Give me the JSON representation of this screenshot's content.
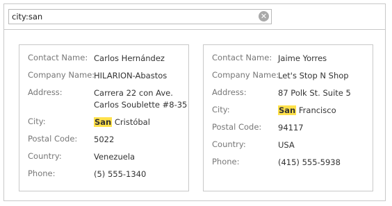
{
  "search": {
    "value": "city:san",
    "placeholder": ""
  },
  "cards": [
    {
      "fields": [
        {
          "label": "Contact Name:",
          "value": "Carlos Hernández"
        },
        {
          "label": "Company Name:",
          "value": "HILARION-Abastos"
        },
        {
          "label": "Address:",
          "value_line1": "Carrera 22 con Ave.",
          "value_line2": "Carlos Soublette #8-35"
        },
        {
          "label": "City:",
          "highlight": "San",
          "rest": "Cristóbal"
        },
        {
          "label": "Postal Code:",
          "value": "5022"
        },
        {
          "label": "Country:",
          "value": "Venezuela"
        },
        {
          "label": "Phone:",
          "value": "(5) 555-1340"
        }
      ]
    },
    {
      "fields": [
        {
          "label": "Contact Name:",
          "value": "Jaime Yorres"
        },
        {
          "label": "Company Name:",
          "value": "Let's Stop N Shop"
        },
        {
          "label": "Address:",
          "value": "87 Polk St. Suite 5"
        },
        {
          "label": "City:",
          "highlight": "San",
          "rest": "Francisco"
        },
        {
          "label": "Postal Code:",
          "value": "94117"
        },
        {
          "label": "Country:",
          "value": "USA"
        },
        {
          "label": "Phone:",
          "value": "(415) 555-5938"
        }
      ]
    }
  ],
  "colors": {
    "highlight": "#ffe14b",
    "border": "#c8c8c8",
    "label": "#777777"
  },
  "icons": {
    "clear": "close-circle-icon"
  }
}
